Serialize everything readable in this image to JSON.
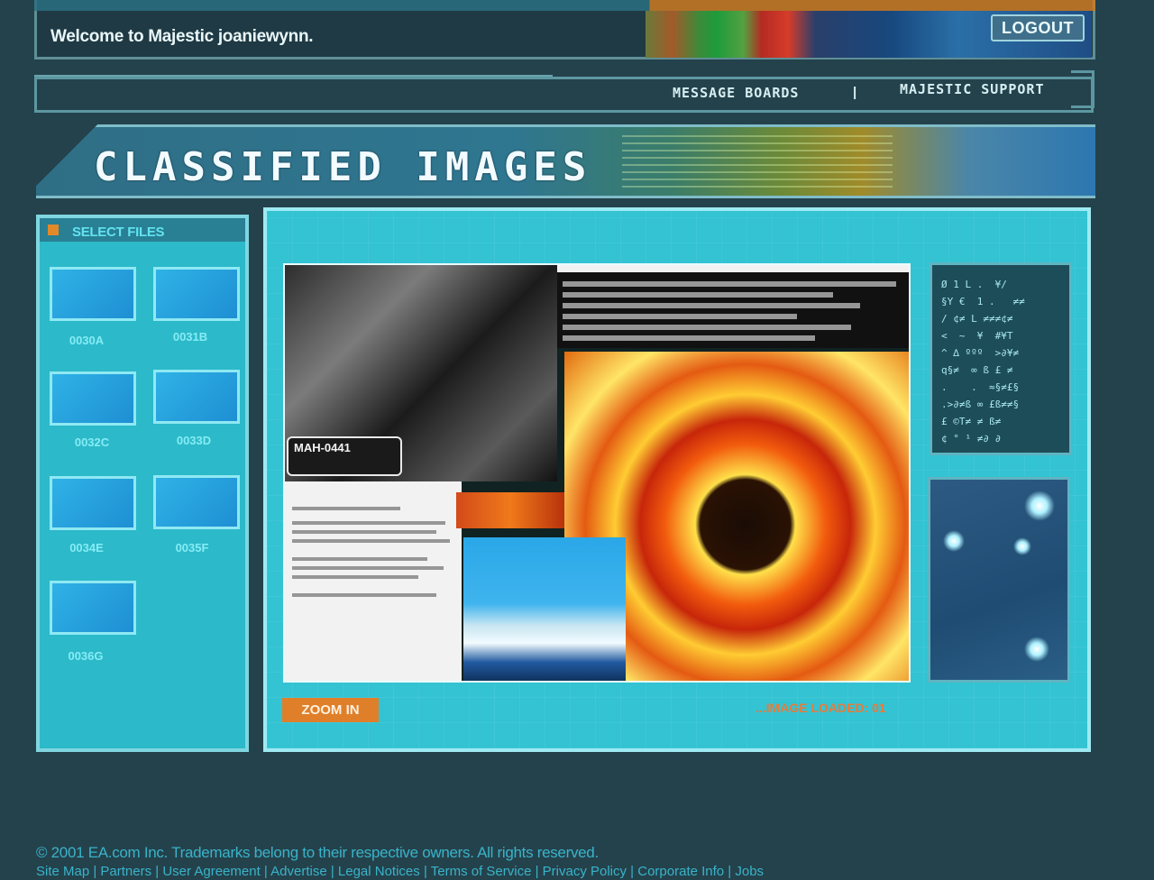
{
  "header": {
    "welcome_text": "Welcome to Majestic joaniewynn.",
    "logout_label": "LOGOUT"
  },
  "nav": {
    "links": [
      "MESSAGE BOARDS",
      "MAJESTIC SUPPORT"
    ],
    "separator": "|"
  },
  "banner": {
    "title": "CLASSIFIED IMAGES"
  },
  "sidebar": {
    "header": "SELECT FILES",
    "files": [
      {
        "label": "0030A"
      },
      {
        "label": "0031B"
      },
      {
        "label": "0032C"
      },
      {
        "label": "0033D"
      },
      {
        "label": "0034E"
      },
      {
        "label": "0035F"
      },
      {
        "label": "0036G"
      }
    ]
  },
  "viewer": {
    "badge_text": "MAH-0441",
    "zoom_label": "ZOOM IN",
    "status_text": "...IMAGE LOADED: 01",
    "code_text": "Ø 1 L .  ¥/\n§Y €  1 .   ≠≠\n/ ¢≠ L ≠≠≠¢≠\n<  ~  ¥  #¥T\n^ ∆ ººº  >∂¥≠\nq§≠  ∞ ß £ ≠\n.    .  ≈§≠£§\n.>∂≠ß ∞ £ß≠≠§\n£ ©T≠ ≠ ß≠\n¢ ° ¹ ≠∂ ∂"
  },
  "footer": {
    "copyright": "© 2001 EA.com Inc. Trademarks belong to their respective owners. All rights reserved.",
    "links": "Site Map | Partners | User Agreement | Advertise | Legal Notices | Terms of Service | Privacy Policy | Corporate Info | Jobs"
  },
  "colors": {
    "background": "#24424c",
    "panel": "#33c3d3",
    "accent_orange": "#e07f2a",
    "status_orange": "#e87b3a",
    "label_cyan": "#85ecf5"
  }
}
